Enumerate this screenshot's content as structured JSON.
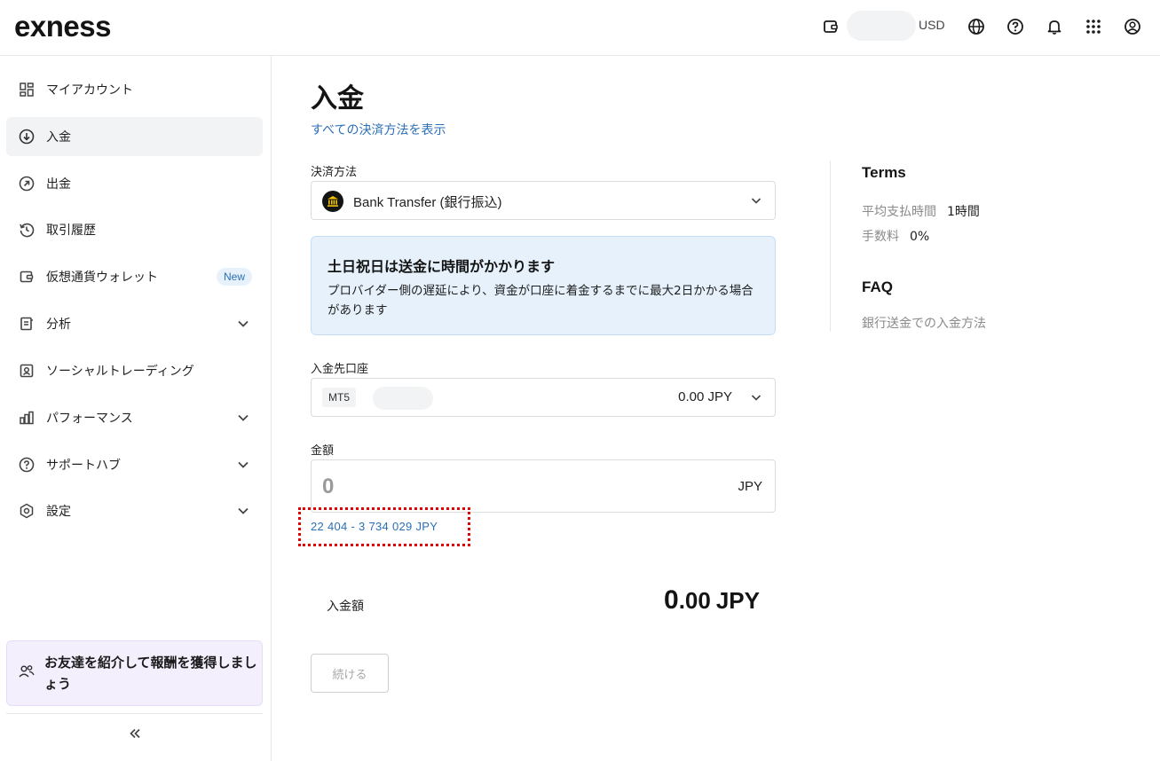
{
  "header": {
    "logo": "exness",
    "currency": "USD",
    "icons": [
      "wallet-icon",
      "globe-icon",
      "help-icon",
      "bell-icon",
      "apps-grid-icon",
      "profile-icon"
    ]
  },
  "sidebar": {
    "items": [
      {
        "label": "マイアカウント",
        "icon": "dashboard-icon"
      },
      {
        "label": "入金",
        "icon": "deposit-icon",
        "active": true
      },
      {
        "label": "出金",
        "icon": "withdraw-icon"
      },
      {
        "label": "取引履歴",
        "icon": "history-icon"
      },
      {
        "label": "仮想通貨ウォレット",
        "icon": "wallet-icon",
        "badge": "New"
      },
      {
        "label": "分析",
        "icon": "analytics-icon",
        "expandable": true
      },
      {
        "label": "ソーシャルトレーディング",
        "icon": "social-trading-icon"
      },
      {
        "label": "パフォーマンス",
        "icon": "bar-chart-icon",
        "expandable": true
      },
      {
        "label": "サポートハブ",
        "icon": "help-icon",
        "expandable": true
      },
      {
        "label": "設定",
        "icon": "settings-icon",
        "expandable": true
      }
    ],
    "referral": "お友達を紹介して報酬を獲得しましょう"
  },
  "main": {
    "title": "入金",
    "all_methods_link": "すべての決済方法を表示",
    "payment_method_label": "決済方法",
    "payment_method_value": "Bank Transfer (銀行振込)",
    "notice": {
      "title": "土日祝日は送金に時間がかかります",
      "body": "プロバイダー側の遅延により、資金が口座に着金するまでに最大2日かかる場合があります"
    },
    "account_label": "入金先口座",
    "account_type": "MT5",
    "account_balance": "0.00 JPY",
    "amount_label": "金額",
    "amount_placeholder": "0",
    "amount_currency": "JPY",
    "amount_range": "22 404 - 3 734 029 JPY",
    "total_label": "入金額",
    "total_int": "0",
    "total_dec": ".00",
    "total_currency": "JPY",
    "continue_button": "続ける"
  },
  "right_panel": {
    "terms_title": "Terms",
    "terms": [
      {
        "label": "平均支払時間",
        "value": "1時間"
      },
      {
        "label": "手数料",
        "value": "0%"
      }
    ],
    "faq_title": "FAQ",
    "faq_link": "銀行送金での入金方法"
  },
  "colors": {
    "accent_link": "#2a6fb6",
    "notice_bg": "#e6f1fb",
    "referral_bg": "#f4effd",
    "highlight": "#e10000"
  }
}
